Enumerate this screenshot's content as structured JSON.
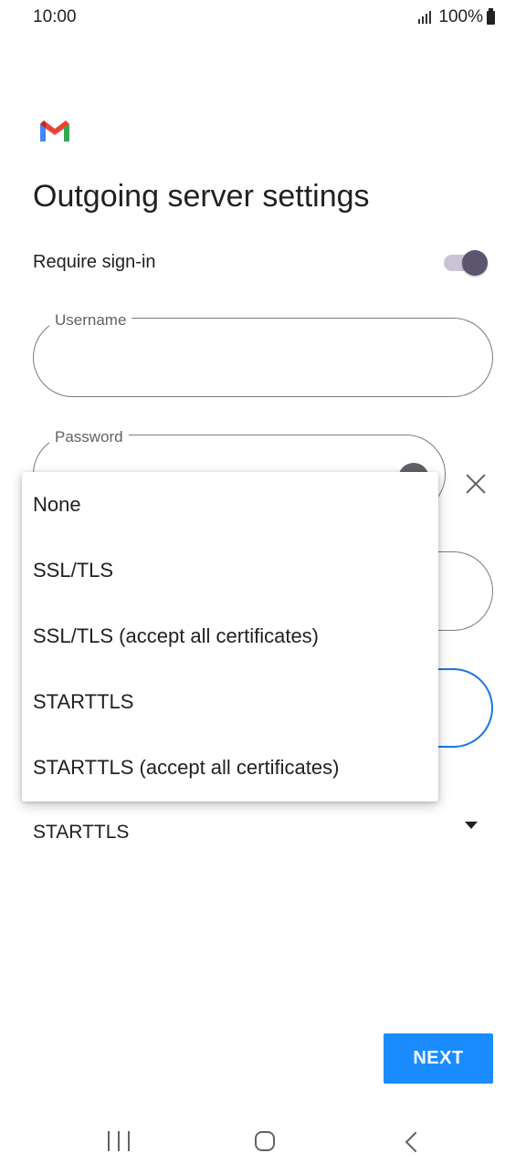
{
  "status_bar": {
    "time": "10:00",
    "battery": "100%"
  },
  "header": {
    "title": "Outgoing server settings"
  },
  "require_signin": {
    "label": "Require sign-in",
    "enabled": true
  },
  "username_field": {
    "label": "Username",
    "value": ""
  },
  "password_field": {
    "label": "Password",
    "value": ""
  },
  "security_type": {
    "selected": "STARTTLS"
  },
  "security_menu": {
    "options": [
      "None",
      "SSL/TLS",
      "SSL/TLS (accept all certificates)",
      "STARTTLS",
      "STARTTLS (accept all certificates)"
    ]
  },
  "footer": {
    "next_label": "NEXT"
  },
  "colors": {
    "accent": "#1a8cff",
    "toggle_thumb": "#5d5470",
    "focus_border": "#1a73e8"
  }
}
